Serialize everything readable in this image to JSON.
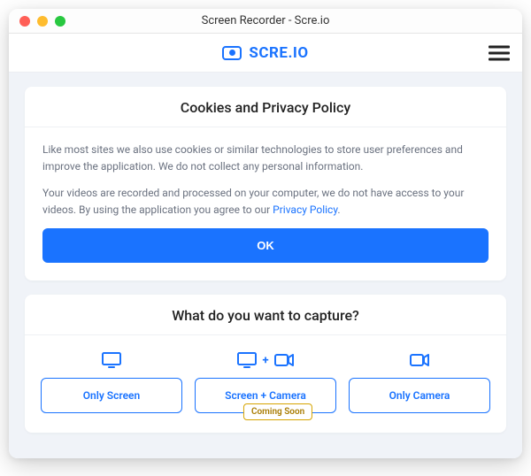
{
  "window": {
    "title": "Screen Recorder - Scre.io"
  },
  "brand": {
    "text": "SCRE.IO"
  },
  "policy": {
    "title": "Cookies and Privacy Policy",
    "p1": "Like most sites we also use cookies or similar technologies to store user preferences and improve the application. We do not collect any personal information.",
    "p2": "Your videos are recorded and processed on your computer, we do not have access to your videos. By using the application you agree to our ",
    "link": "Privacy Policy",
    "ok": "OK"
  },
  "capture": {
    "title": "What do you want to capture?",
    "only_screen": "Only Screen",
    "screen_camera": "Screen + Camera",
    "only_camera": "Only Camera",
    "coming_soon": "Coming Soon",
    "plus": "+"
  }
}
